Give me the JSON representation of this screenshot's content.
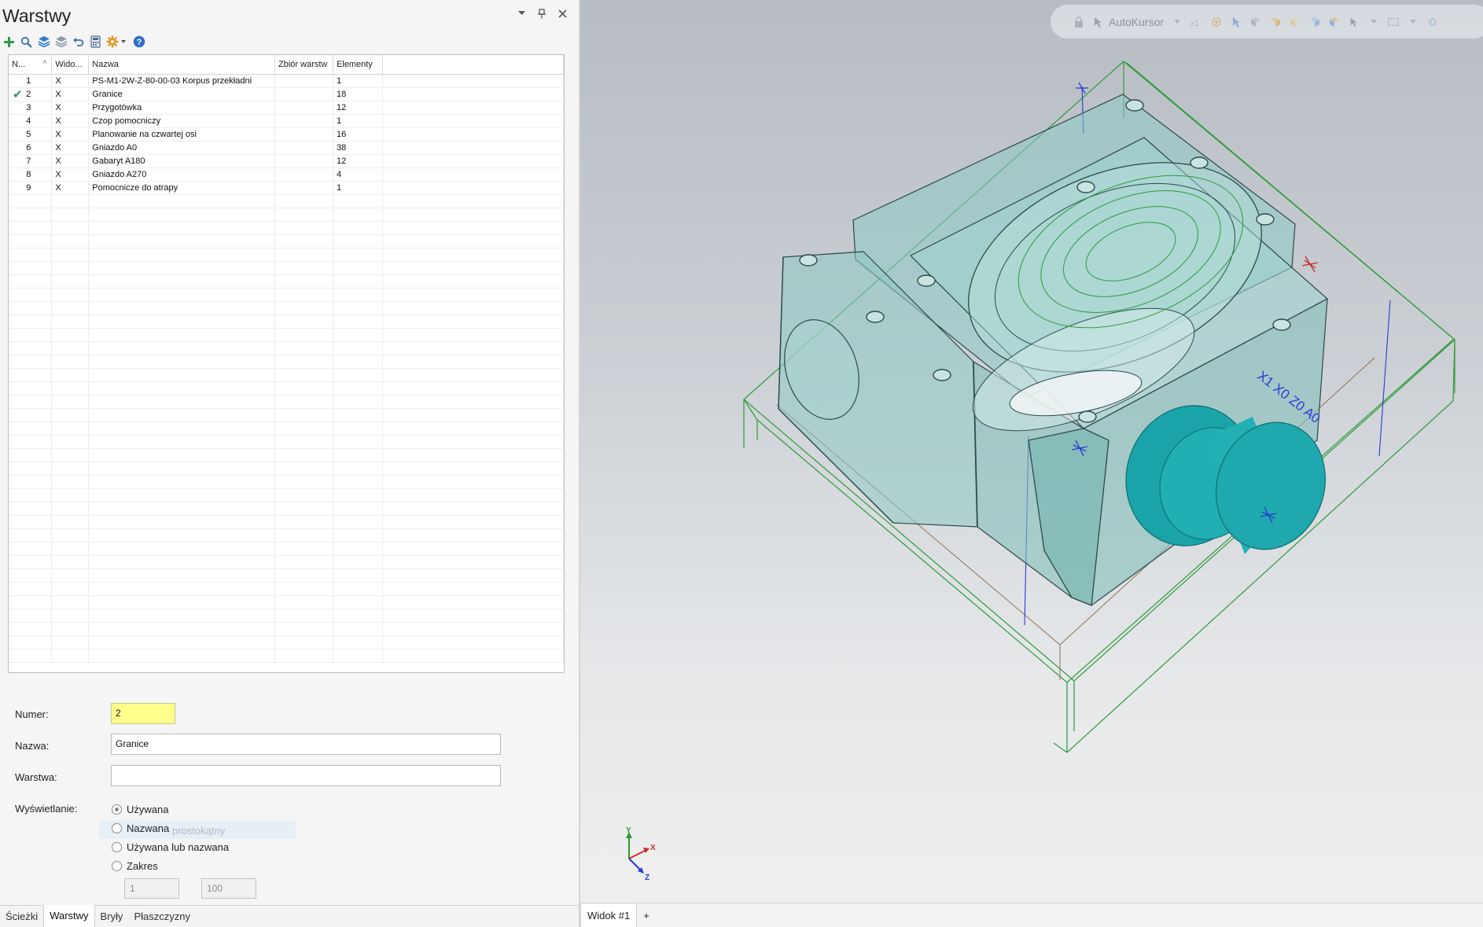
{
  "panel": {
    "title": "Warstwy",
    "controls": {
      "dropdown_icon": "chevron-down-icon",
      "pin_icon": "pin-icon",
      "close_icon": "close-icon"
    }
  },
  "toolbar": {
    "icons": [
      "add-icon",
      "search-icon",
      "layers-icon",
      "layers-grey-icon",
      "undo-icon",
      "calculator-icon",
      "gear-icon",
      "help-icon"
    ]
  },
  "table": {
    "columns": [
      "N...",
      "Wido...",
      "Nazwa",
      "Zbiór warstw",
      "Elementy"
    ],
    "rows": [
      {
        "num": "1",
        "visible": "X",
        "name": "PS-M1-2W-Z-80-00-03 Korpus przekładni",
        "set": "",
        "count": "1",
        "checked": false
      },
      {
        "num": "2",
        "visible": "X",
        "name": "Granice",
        "set": "",
        "count": "18",
        "checked": true
      },
      {
        "num": "3",
        "visible": "X",
        "name": "Przygotówka",
        "set": "",
        "count": "12",
        "checked": false
      },
      {
        "num": "4",
        "visible": "X",
        "name": "Czop pomocniczy",
        "set": "",
        "count": "1",
        "checked": false
      },
      {
        "num": "5",
        "visible": "X",
        "name": "Planowanie na czwartej osi",
        "set": "",
        "count": "16",
        "checked": false
      },
      {
        "num": "6",
        "visible": "X",
        "name": "Gniazdo A0",
        "set": "",
        "count": "38",
        "checked": false
      },
      {
        "num": "7",
        "visible": "X",
        "name": "Gabaryt A180",
        "set": "",
        "count": "12",
        "checked": false
      },
      {
        "num": "8",
        "visible": "X",
        "name": "Gniazdo A270",
        "set": "",
        "count": "4",
        "checked": false
      },
      {
        "num": "9",
        "visible": "X",
        "name": "Pomocnicze do atrapy",
        "set": "",
        "count": "1",
        "checked": false
      }
    ]
  },
  "form": {
    "numer_label": "Numer:",
    "numer_value": "2",
    "nazwa_label": "Nazwa:",
    "nazwa_value": "Granice",
    "warstwa_label": "Warstwa:",
    "warstwa_value": "",
    "wyswietlanie_label": "Wyświetlanie:",
    "options": [
      "Używana",
      "Nazwana",
      "Używana lub nazwana",
      "Zakres"
    ],
    "selected_option": 0,
    "ghost_text": "prostokątny",
    "range_from": "1",
    "range_to": "100"
  },
  "bottom_tabs": [
    "Ścieżki",
    "Warstwy",
    "Bryły",
    "Płaszczyzny"
  ],
  "active_bottom_tab": 1,
  "viewport": {
    "toolbar_label": "AutoKursor",
    "axis_labels": {
      "x": "X",
      "y": "Y",
      "z": "Z"
    },
    "axis_colors": {
      "x": "#d42a2a",
      "y": "#2a9a2a",
      "z": "#2a3ad4"
    },
    "model_text": "X1 X0 Z0 A0",
    "model_color": "#7fc6c4",
    "accent_teal": "#1aa3a8"
  },
  "view_tabs": [
    "Widok #1",
    "+"
  ]
}
